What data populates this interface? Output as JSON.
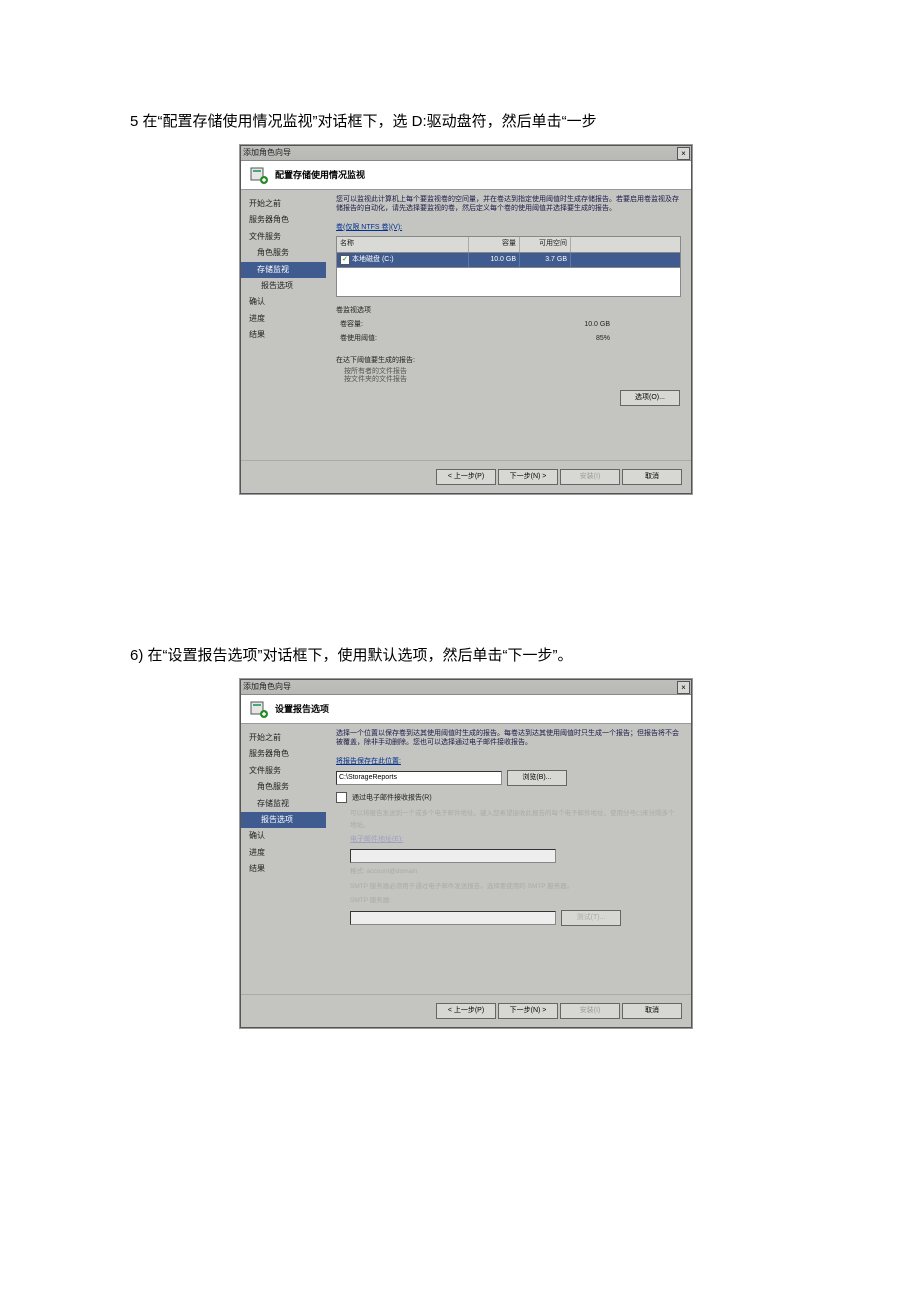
{
  "caption1": "5 在“配置存储使用情况监视”对话框下，选 D:驱动盘符，然后单击“一步",
  "caption2": "6) 在“设置报告选项”对话框下，使用默认选项，然后单击“下一步”。",
  "dlg1": {
    "titlebar": "添加角色向导",
    "banner": "配置存储使用情况监视",
    "sidebar": {
      "before": "开始之前",
      "serverRoles": "服务器角色",
      "fileServices": "文件服务",
      "roleServices": "角色服务",
      "storageMon": "存储监视",
      "reportOpt": "报告选项",
      "confirm": "确认",
      "progress": "进度",
      "result": "结果"
    },
    "desc": "您可以监视此计算机上每个要监视卷的空间量，并在卷达到指定使用阈值时生成存储报告。若要启用卷监视及存储报告的自动化，请先选择要监视的卷，然后定义每个卷的使用阈值并选择要生成的报告。",
    "volumesLabel": "卷(仅限 NTFS 卷)(V):",
    "columns": {
      "name": "名称",
      "cap": "容量",
      "free": "可用空间"
    },
    "row": {
      "name": "本地磁盘 (C:)",
      "cap": "10.0 GB",
      "free": "3.7 GB"
    },
    "monOptTitle": "卷监视选项",
    "pair1": {
      "l": "卷容量:",
      "v": "10.0 GB"
    },
    "pair2": {
      "l": "卷使用阈值:",
      "v": "85%"
    },
    "reportsLine": "在达下阈值要生成的报告:",
    "rline1": "按所有者的文件报告",
    "rline2": "按文件夹的文件报告",
    "optionsBtn": "选项(O)...",
    "footer": {
      "prev": "< 上一步(P)",
      "next": "下一步(N) >",
      "install": "安装(I)",
      "cancel": "取消"
    }
  },
  "dlg2": {
    "titlebar": "添加角色向导",
    "banner": "设置报告选项",
    "sidebar": {
      "before": "开始之前",
      "serverRoles": "服务器角色",
      "fileServices": "文件服务",
      "roleServices": "角色服务",
      "storageMon": "存储监视",
      "reportOpt": "报告选项",
      "confirm": "确认",
      "progress": "进度",
      "result": "结果"
    },
    "desc": "选择一个位置以保存卷到达其使用阈值时生成的报告。每卷达到达其使用阈值时只生成一个报告；但报告将不会被覆盖，除非手动删除。您也可以选择通过电子邮件接收报告。",
    "saveLabel": "将报告保存在此位置:",
    "path": "C:\\StorageReports",
    "browse": "浏览(B)...",
    "chkLabel": "通过电子邮件接收报告(R)",
    "emailNote": "可以将报告发送到一个或多个电子邮件地址。键入您希望接收此报告的每个电子邮件地址，使用分号(;)来分隔多个地址。",
    "emailLabel": "电子邮件地址(E):",
    "fmt": "格式: account@domain",
    "smtpNote": "SMTP 服务器必须用于通过电子邮件发送报告。选择要使用的 SMTP 服务器。",
    "smtpLabel": "SMTP 服务器:",
    "testBtn": "测试(T)...",
    "footer": {
      "prev": "< 上一步(P)",
      "next": "下一步(N) >",
      "install": "安装(I)",
      "cancel": "取消"
    }
  }
}
